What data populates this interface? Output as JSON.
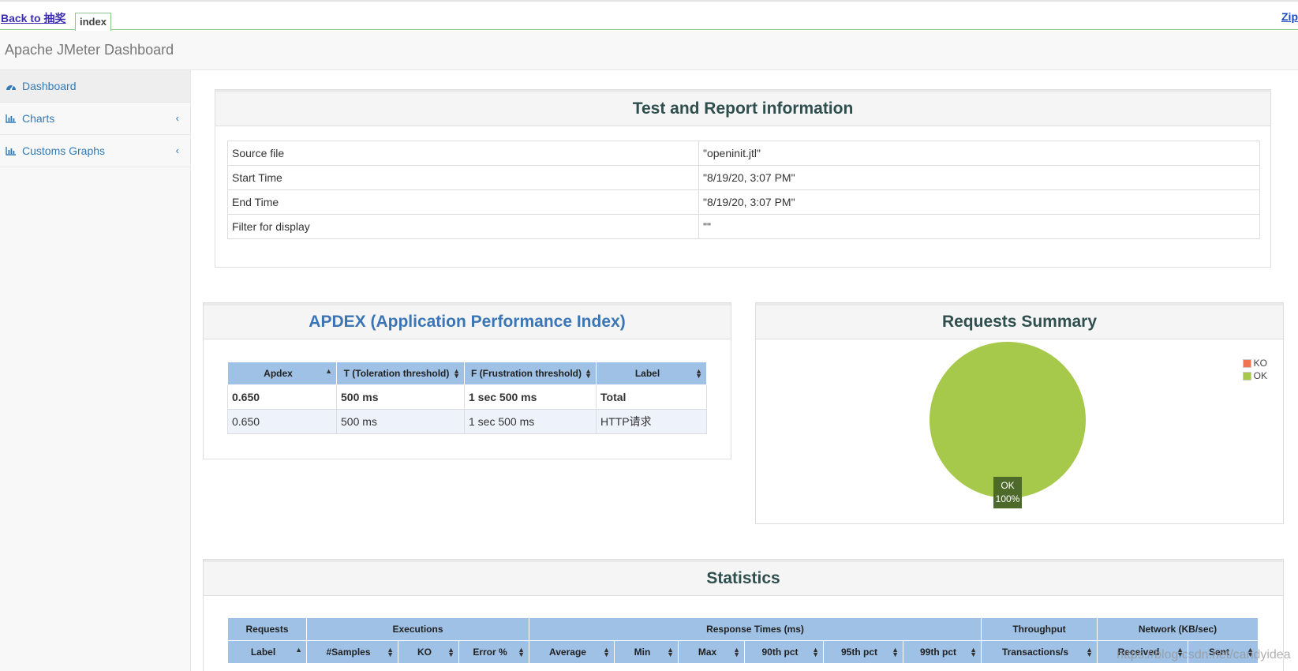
{
  "topbar": {
    "back_link": "Back to 抽奖",
    "tab": "index",
    "zip": "Zip"
  },
  "brand": "Apache JMeter Dashboard",
  "sidebar": {
    "items": [
      {
        "label": "Dashboard",
        "icon": "dashboard-icon"
      },
      {
        "label": "Charts",
        "icon": "bar-chart-icon"
      },
      {
        "label": "Customs Graphs",
        "icon": "bar-chart-icon"
      }
    ]
  },
  "report_info": {
    "title": "Test and Report information",
    "rows": [
      {
        "key": "Source file",
        "value": "\"openinit.jtl\""
      },
      {
        "key": "Start Time",
        "value": "\"8/19/20, 3:07 PM\""
      },
      {
        "key": "End Time",
        "value": "\"8/19/20, 3:07 PM\""
      },
      {
        "key": "Filter for display",
        "value": "\"\""
      }
    ]
  },
  "apdex": {
    "title": "APDEX (Application Performance Index)",
    "headers": [
      "Apdex",
      "T (Toleration threshold)",
      "F (Frustration threshold)",
      "Label"
    ],
    "rows": [
      [
        "0.650",
        "500 ms",
        "1 sec 500 ms",
        "Total"
      ],
      [
        "0.650",
        "500 ms",
        "1 sec 500 ms",
        "HTTP请求"
      ]
    ]
  },
  "requests_summary": {
    "title": "Requests Summary",
    "legend": [
      {
        "name": "KO",
        "color": "#f0744f"
      },
      {
        "name": "OK",
        "color": "#a7c94b"
      }
    ],
    "slice_label": "OK",
    "slice_percent": "100%"
  },
  "chart_data": {
    "type": "pie",
    "title": "Requests Summary",
    "slices": [
      {
        "label": "KO",
        "value": 0,
        "color": "#f0744f"
      },
      {
        "label": "OK",
        "value": 100,
        "color": "#a7c94b"
      }
    ],
    "legend": "top-right"
  },
  "statistics": {
    "title": "Statistics",
    "groups": [
      "Requests",
      "Executions",
      "Response Times (ms)",
      "Throughput",
      "Network (KB/sec)"
    ],
    "columns": [
      "Label",
      "#Samples",
      "KO",
      "Error %",
      "Average",
      "Min",
      "Max",
      "90th pct",
      "95th pct",
      "99th pct",
      "Transactions/s",
      "Received",
      "Sent"
    ]
  },
  "watermark": "https://blog.csdn.net/candyidea"
}
